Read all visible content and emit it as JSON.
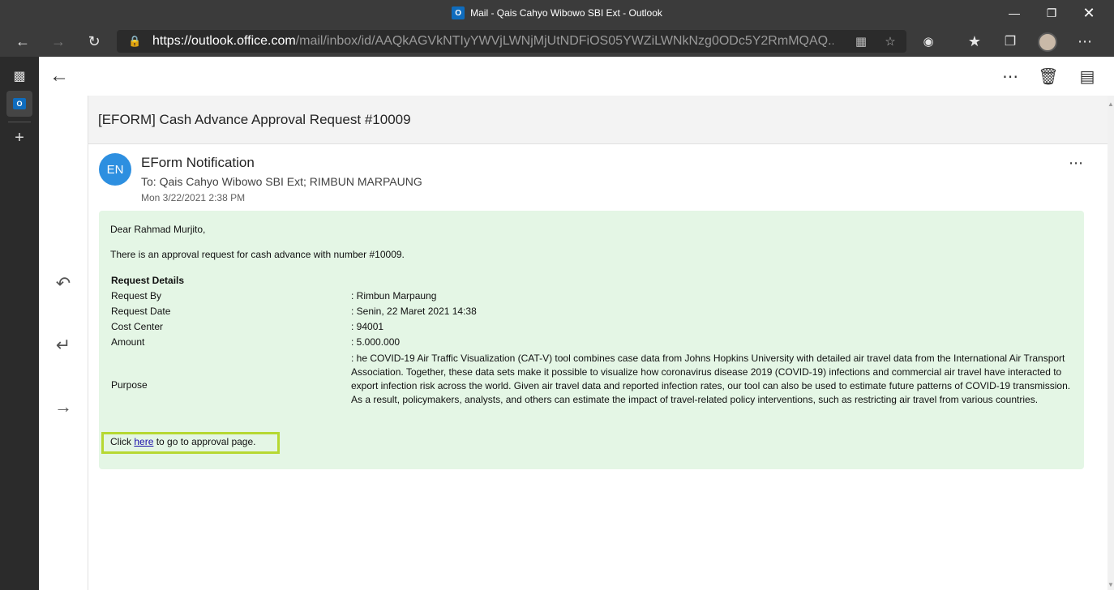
{
  "window": {
    "title": "Mail - Qais Cahyo Wibowo SBI Ext - Outlook"
  },
  "browser": {
    "url_host": "https://outlook.office.com",
    "url_path": "/mail/inbox/id/AAQkAGVkNTIyYWVjLWNjMjUtNDFiOS05YWZiLWNkNzg0ODc5Y2RmMQAQ..."
  },
  "message": {
    "subject": "[EFORM] Cash Advance Approval Request #10009",
    "sender_initials": "EN",
    "sender_name": "EForm Notification",
    "to_line": "To: Qais Cahyo Wibowo SBI Ext;  RIMBUN MARPAUNG",
    "date": "Mon 3/22/2021 2:38 PM",
    "body": {
      "greeting": "Dear Rahmad Murjito,",
      "intro": "There is an approval request for cash advance with number #10009.",
      "details_heading": "Request Details",
      "rows": [
        {
          "label": "Request By",
          "value": ": Rimbun Marpaung"
        },
        {
          "label": "Request Date",
          "value": ": Senin, 22 Maret 2021 14:38"
        },
        {
          "label": "Cost Center",
          "value": ": 94001"
        },
        {
          "label": "Amount",
          "value": ": 5.000.000"
        }
      ],
      "purpose_label": "Purpose",
      "purpose_value": ": he COVID-19 Air Traffic Visualization (CAT-V) tool combines case data from Johns Hopkins University with detailed air travel data from the International Air Transport Association. Together, these data sets make it possible to visualize how coronavirus disease 2019 (COVID-19) infections and commercial air travel have interacted to export infection risk across the world. Given air travel data and reported infection rates, our tool can also be used to estimate future patterns of COVID-19 transmission. As a result, policymakers, analysts, and others can estimate the impact of travel-related policy interventions, such as restricting air travel from various countries.",
      "link_prefix": "Click ",
      "link_text": "here",
      "link_suffix": " to go to approval page."
    }
  },
  "icons": {
    "back": "back-arrow-icon",
    "forward": "forward-arrow-icon",
    "refresh": "refresh-icon",
    "lock": "lock-icon",
    "more": "more-horizontal-icon",
    "delete": "trash-icon",
    "archive": "archive-icon",
    "reply": "reply-icon",
    "reply_all": "reply-all-icon",
    "forward_mail": "forward-mail-icon"
  },
  "colors": {
    "chrome_dark": "#3b3b3b",
    "avatar_blue": "#2d8fe0",
    "body_green": "#e4f6e5",
    "highlight": "#b6d832"
  }
}
